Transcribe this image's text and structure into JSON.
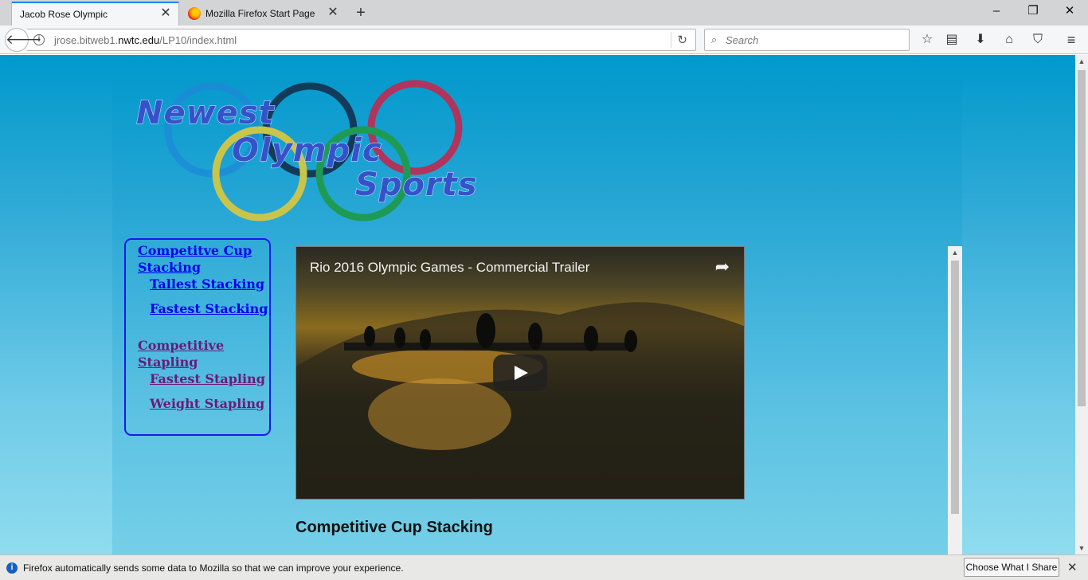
{
  "browser": {
    "tabs": [
      {
        "label": "Jacob Rose Olympic"
      },
      {
        "label": "Mozilla Firefox Start Page"
      }
    ],
    "url": {
      "prefix": "jrose.bitweb1.",
      "host": "nwtc.edu",
      "path": "/LP10/index.html"
    },
    "search_placeholder": "Search",
    "notification": {
      "text": "Firefox automatically sends some data to Mozilla so that we can improve your experience.",
      "button": "Choose What I Share"
    }
  },
  "page": {
    "logo": {
      "line1": "Newest",
      "line2": "Olympic",
      "line3": "Sports"
    },
    "nav": [
      {
        "label": "Competitve Cup Stacking",
        "kind": "top"
      },
      {
        "label": "Tallest Stacking",
        "kind": "sub"
      },
      {
        "label": "Fastest Stacking",
        "kind": "sub"
      },
      {
        "label": "Competitive Stapling",
        "kind": "top-visited"
      },
      {
        "label": "Fastest Stapling",
        "kind": "sub-visited"
      },
      {
        "label": "Weight Stapling",
        "kind": "sub-visited"
      }
    ],
    "video_title": "Rio 2016 Olympic Games - Commercial Trailer",
    "section_heading": "Competitive Cup Stacking"
  },
  "colors": {
    "accent": "#0a84ff",
    "link": "#0000ee",
    "visited": "#6a1b7a",
    "nav_border": "#1a1ae6",
    "ring_blue": "#1e88d8",
    "ring_navy": "#123a5a",
    "ring_red": "#b0345c",
    "ring_yellow": "#c9c44a",
    "ring_green": "#1f9a55"
  }
}
